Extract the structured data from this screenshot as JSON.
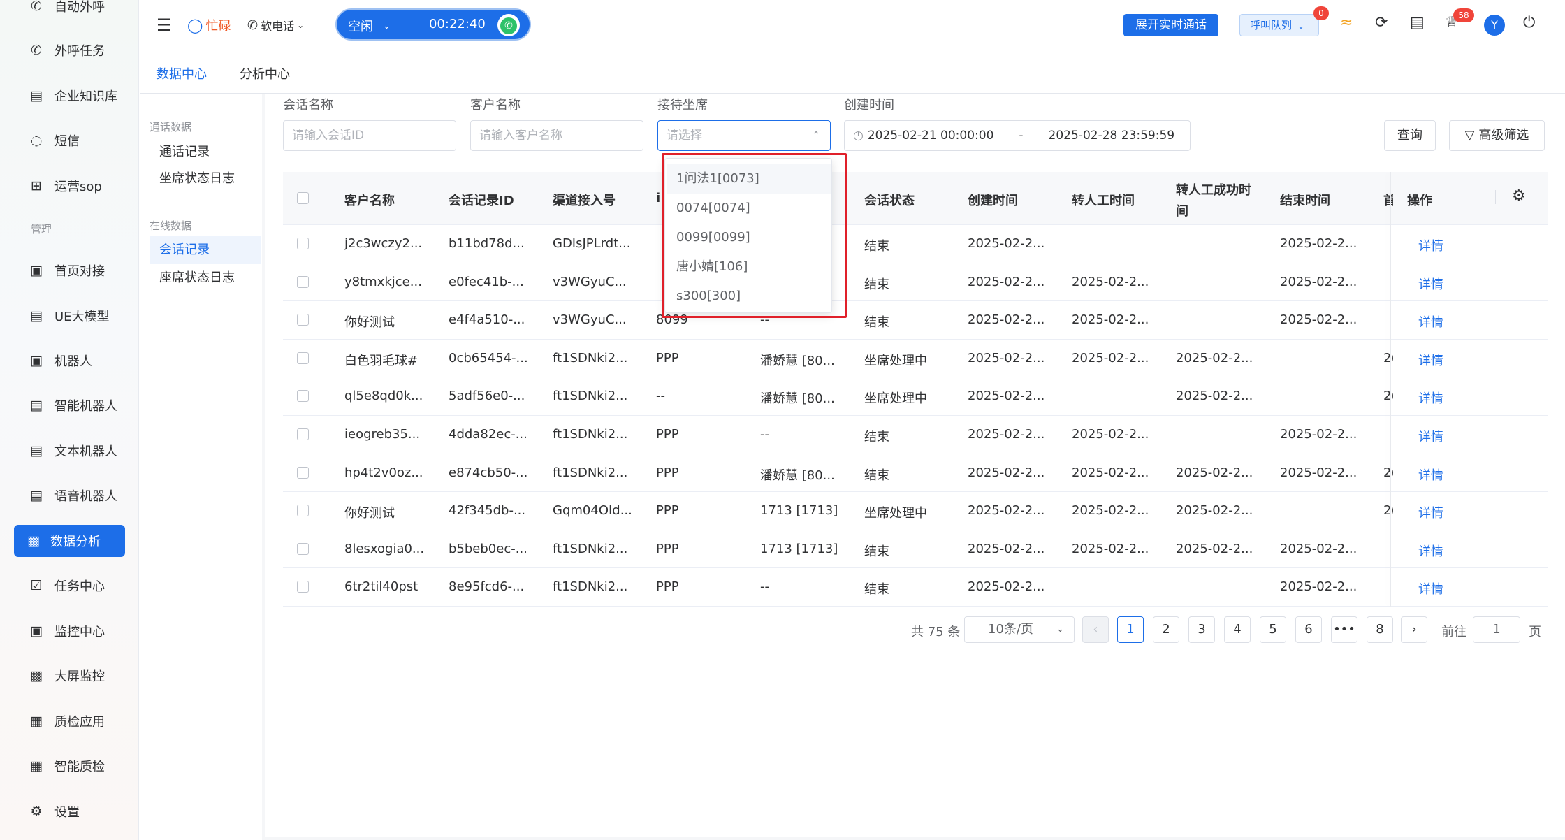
{
  "sidebar": {
    "items": [
      {
        "label": "自动外呼",
        "icon": "phone-auto-icon"
      },
      {
        "label": "外呼任务",
        "icon": "phone-task-icon"
      },
      {
        "label": "企业知识库",
        "icon": "book-icon"
      },
      {
        "label": "短信",
        "icon": "sms-icon"
      },
      {
        "label": "运营sop",
        "icon": "flow-icon"
      }
    ],
    "group_label": "管理",
    "items2": [
      {
        "label": "首页对接",
        "icon": "chart-monitor-icon"
      },
      {
        "label": "UE大模型",
        "icon": "doc-icon"
      },
      {
        "label": "机器人",
        "icon": "robot-icon"
      },
      {
        "label": "智能机器人",
        "icon": "doc-icon"
      },
      {
        "label": "文本机器人",
        "icon": "doc-icon"
      },
      {
        "label": "语音机器人",
        "icon": "doc-icon"
      },
      {
        "label": "数据分析",
        "icon": "bar-chart-icon"
      },
      {
        "label": "任务中心",
        "icon": "calendar-check-icon"
      },
      {
        "label": "监控中心",
        "icon": "monitor-icon"
      },
      {
        "label": "大屏监控",
        "icon": "bar-chart-icon"
      },
      {
        "label": "质检应用",
        "icon": "inspect-icon"
      },
      {
        "label": "智能质检",
        "icon": "inspect-icon"
      },
      {
        "label": "设置",
        "icon": "gear-icon"
      }
    ]
  },
  "topbar": {
    "brand": "忙碌",
    "softphone": "软电话",
    "status": "空闲",
    "timer": "00:22:40",
    "realtime_button": "展开实时通话",
    "queue_label": "呼叫队列",
    "queue_badge": "0",
    "notif_badge": "58",
    "avatar_letter": "Y"
  },
  "tabs": [
    "数据中心",
    "分析中心"
  ],
  "leftpanel": {
    "group1": "通话数据",
    "group1_items": [
      "通话记录",
      "坐席状态日志"
    ],
    "group2": "在线数据",
    "group2_items": [
      "会话记录",
      "座席状态日志"
    ]
  },
  "filters": {
    "session_name_label": "会话名称",
    "session_name_placeholder": "请输入会话ID",
    "customer_name_label": "客户名称",
    "customer_name_placeholder": "请输入客户名称",
    "agent_label": "接待坐席",
    "agent_placeholder": "请选择",
    "created_label": "创建时间",
    "date_start": "2025-02-21 00:00:00",
    "date_sep": "-",
    "date_end": "2025-02-28 23:59:59",
    "query_button": "查询",
    "advanced_button": "高级筛选"
  },
  "dropdown": {
    "options": [
      "1问法1[0073]",
      "0074[0074]",
      "0099[0099]",
      "唐小婧[106]",
      "s300[300]"
    ]
  },
  "table": {
    "headers": [
      "客户名称",
      "会话记录ID",
      "渠道接入号",
      "会话状态",
      "创建时间",
      "转人工时间",
      "转人工成功时",
      "间",
      "结束时间",
      "首",
      "操作"
    ],
    "partial_header_char": "i",
    "rows": [
      {
        "customer": "j2c3wczy2...",
        "id": "b11bd78d...",
        "channel": "GDIsJPLrdt...",
        "ch_no": "",
        "agent": "",
        "status": "结束",
        "created": "2025-02-2...",
        "transfer": "",
        "transfer_ok": "",
        "end": "2025-02-2...",
        "first": "",
        "action": "详情"
      },
      {
        "customer": "y8tmxkjce...",
        "id": "e0fec41b-...",
        "channel": "v3WGyuC...",
        "ch_no": "",
        "agent": "",
        "status": "结束",
        "created": "2025-02-2...",
        "transfer": "2025-02-2...",
        "transfer_ok": "",
        "end": "2025-02-2...",
        "first": "",
        "action": "详情"
      },
      {
        "customer": "你好测试",
        "id": "e4f4a510-...",
        "channel": "v3WGyuC...",
        "ch_no": "8099",
        "agent": "--",
        "status": "结束",
        "created": "2025-02-2...",
        "transfer": "2025-02-2...",
        "transfer_ok": "",
        "end": "2025-02-2...",
        "first": "",
        "action": "详情"
      },
      {
        "customer": "白色羽毛球#",
        "id": "0cb65454-...",
        "channel": "ft1SDNki2...",
        "ch_no": "PPP",
        "agent": "潘娇慧 [80...",
        "status": "坐席处理中",
        "created": "2025-02-2...",
        "transfer": "2025-02-2...",
        "transfer_ok": "2025-02-2...",
        "end": "",
        "first": "2(",
        "action": "详情"
      },
      {
        "customer": "ql5e8qd0k...",
        "id": "5adf56e0-...",
        "channel": "ft1SDNki2...",
        "ch_no": "--",
        "agent": "潘娇慧 [80...",
        "status": "坐席处理中",
        "created": "2025-02-2...",
        "transfer": "",
        "transfer_ok": "2025-02-2...",
        "end": "",
        "first": "2(",
        "action": "详情"
      },
      {
        "customer": "ieogreb35...",
        "id": "4dda82ec-...",
        "channel": "ft1SDNki2...",
        "ch_no": "PPP",
        "agent": "--",
        "status": "结束",
        "created": "2025-02-2...",
        "transfer": "2025-02-2...",
        "transfer_ok": "",
        "end": "2025-02-2...",
        "first": "",
        "action": "详情"
      },
      {
        "customer": "hp4t2v0oz...",
        "id": "e874cb50-...",
        "channel": "ft1SDNki2...",
        "ch_no": "PPP",
        "agent": "潘娇慧 [80...",
        "status": "结束",
        "created": "2025-02-2...",
        "transfer": "2025-02-2...",
        "transfer_ok": "2025-02-2...",
        "end": "2025-02-2...",
        "first": "2(",
        "action": "详情"
      },
      {
        "customer": "你好测试",
        "id": "42f345db-...",
        "channel": "Gqm04OId...",
        "ch_no": "PPP",
        "agent": "1713 [1713]",
        "status": "坐席处理中",
        "created": "2025-02-2...",
        "transfer": "2025-02-2...",
        "transfer_ok": "2025-02-2...",
        "end": "",
        "first": "2(",
        "action": "详情"
      },
      {
        "customer": "8lesxogia0...",
        "id": "b5beb0ec-...",
        "channel": "ft1SDNki2...",
        "ch_no": "PPP",
        "agent": "1713 [1713]",
        "status": "结束",
        "created": "2025-02-2...",
        "transfer": "2025-02-2...",
        "transfer_ok": "2025-02-2...",
        "end": "2025-02-2...",
        "first": "",
        "action": "详情"
      },
      {
        "customer": "6tr2til40pst",
        "id": "8e95fcd6-...",
        "channel": "ft1SDNki2...",
        "ch_no": "PPP",
        "agent": "--",
        "status": "结束",
        "created": "2025-02-2...",
        "transfer": "",
        "transfer_ok": "",
        "end": "2025-02-2...",
        "first": "",
        "action": "详情"
      }
    ]
  },
  "pagination": {
    "total": "共 75 条",
    "page_size": "10条/页",
    "pages": [
      "1",
      "2",
      "3",
      "4",
      "5",
      "6",
      "•••",
      "8"
    ],
    "current": "1",
    "goto_label": "前往",
    "goto_value": "1",
    "page_unit": "页"
  },
  "colors": {
    "accent": "#1d6ee8",
    "highlight": "#e0202a"
  }
}
